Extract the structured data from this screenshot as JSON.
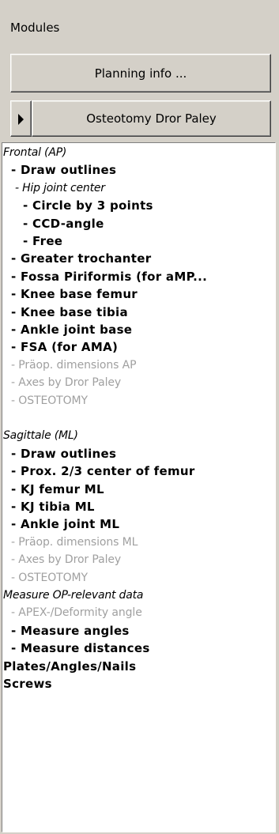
{
  "panel": {
    "modules_label": "Modules",
    "planning_button_label": "Planning info ...",
    "module_selector_label": "Osteotomy Dror Paley"
  },
  "tree": [
    {
      "label": "Frontal (AP)",
      "style": "heading",
      "indent": 0
    },
    {
      "label": "- Draw outlines",
      "style": "active",
      "indent": 1
    },
    {
      "label": "- Hip joint center",
      "style": "heading",
      "indent": 1
    },
    {
      "label": "- Circle by 3 points",
      "style": "active",
      "indent": 2
    },
    {
      "label": "- CCD-angle",
      "style": "active",
      "indent": 2
    },
    {
      "label": "- Free",
      "style": "active",
      "indent": 2
    },
    {
      "label": "- Greater trochanter",
      "style": "active",
      "indent": 1
    },
    {
      "label": "- Fossa Piriformis (for aMP...",
      "style": "active",
      "indent": 1
    },
    {
      "label": "- Knee base femur",
      "style": "active",
      "indent": 1
    },
    {
      "label": "- Knee base tibia",
      "style": "active",
      "indent": 1
    },
    {
      "label": "- Ankle joint base",
      "style": "active",
      "indent": 1
    },
    {
      "label": "- FSA (for AMA)",
      "style": "active",
      "indent": 1
    },
    {
      "label": "- Präop. dimensions AP",
      "style": "disabled",
      "indent": 1
    },
    {
      "label": "- Axes by Dror Paley",
      "style": "disabled",
      "indent": 1
    },
    {
      "label": "- OSTEOTOMY",
      "style": "disabled",
      "indent": 1
    },
    {
      "label": "",
      "style": "spacer",
      "indent": 0
    },
    {
      "label": "Sagittale (ML)",
      "style": "heading",
      "indent": 0
    },
    {
      "label": "- Draw outlines",
      "style": "active",
      "indent": 1
    },
    {
      "label": "- Prox. 2/3 center of femur",
      "style": "active",
      "indent": 1
    },
    {
      "label": "- KJ femur ML",
      "style": "active",
      "indent": 1
    },
    {
      "label": "- KJ tibia ML",
      "style": "active",
      "indent": 1
    },
    {
      "label": "- Ankle joint ML",
      "style": "active",
      "indent": 1
    },
    {
      "label": "- Präop. dimensions ML",
      "style": "disabled",
      "indent": 1
    },
    {
      "label": "- Axes by Dror Paley",
      "style": "disabled",
      "indent": 1
    },
    {
      "label": "- OSTEOTOMY",
      "style": "disabled",
      "indent": 1
    },
    {
      "label": "Measure OP-relevant data",
      "style": "heading",
      "indent": 0
    },
    {
      "label": "- APEX-/Deformity angle",
      "style": "disabled",
      "indent": 1
    },
    {
      "label": "- Measure angles",
      "style": "active",
      "indent": 1
    },
    {
      "label": "- Measure distances",
      "style": "active",
      "indent": 1
    },
    {
      "label": "Plates/Angles/Nails",
      "style": "active",
      "indent": 0
    },
    {
      "label": "Screws",
      "style": "active",
      "indent": 0
    }
  ]
}
